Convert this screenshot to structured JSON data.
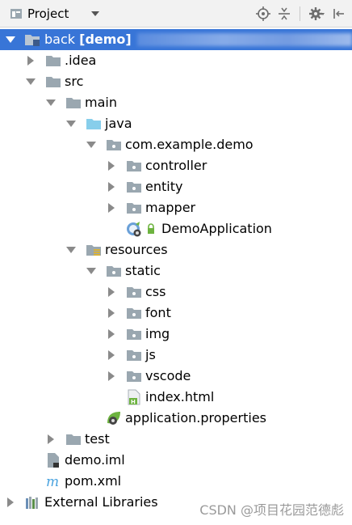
{
  "toolbar": {
    "view_label": "Project",
    "icons": [
      "project-view-icon",
      "locate-icon",
      "collapse-all-icon",
      "settings-gear-icon",
      "hide-panel-icon"
    ]
  },
  "tree": {
    "root": {
      "label": "back",
      "module_tag": "[demo]"
    },
    "items": {
      "idea": ".idea",
      "src": "src",
      "main": "main",
      "java": "java",
      "package": "com.example.demo",
      "controller": "controller",
      "entity": "entity",
      "mapper": "mapper",
      "demo_application": "DemoApplication",
      "resources": "resources",
      "static": "static",
      "css": "css",
      "font": "font",
      "img": "img",
      "js": "js",
      "vscode": "vscode",
      "index_html": "index.html",
      "application_properties": "application.properties",
      "test": "test",
      "demo_iml": "demo.iml",
      "pom_xml": "pom.xml",
      "external_libraries": "External Libraries"
    }
  },
  "watermark": "CSDN @项目花园范德彪",
  "colors": {
    "selection": "#3875d7",
    "folder": "#9aa7b0",
    "source_folder": "#87ceeb",
    "spring_green": "#6db33f"
  }
}
